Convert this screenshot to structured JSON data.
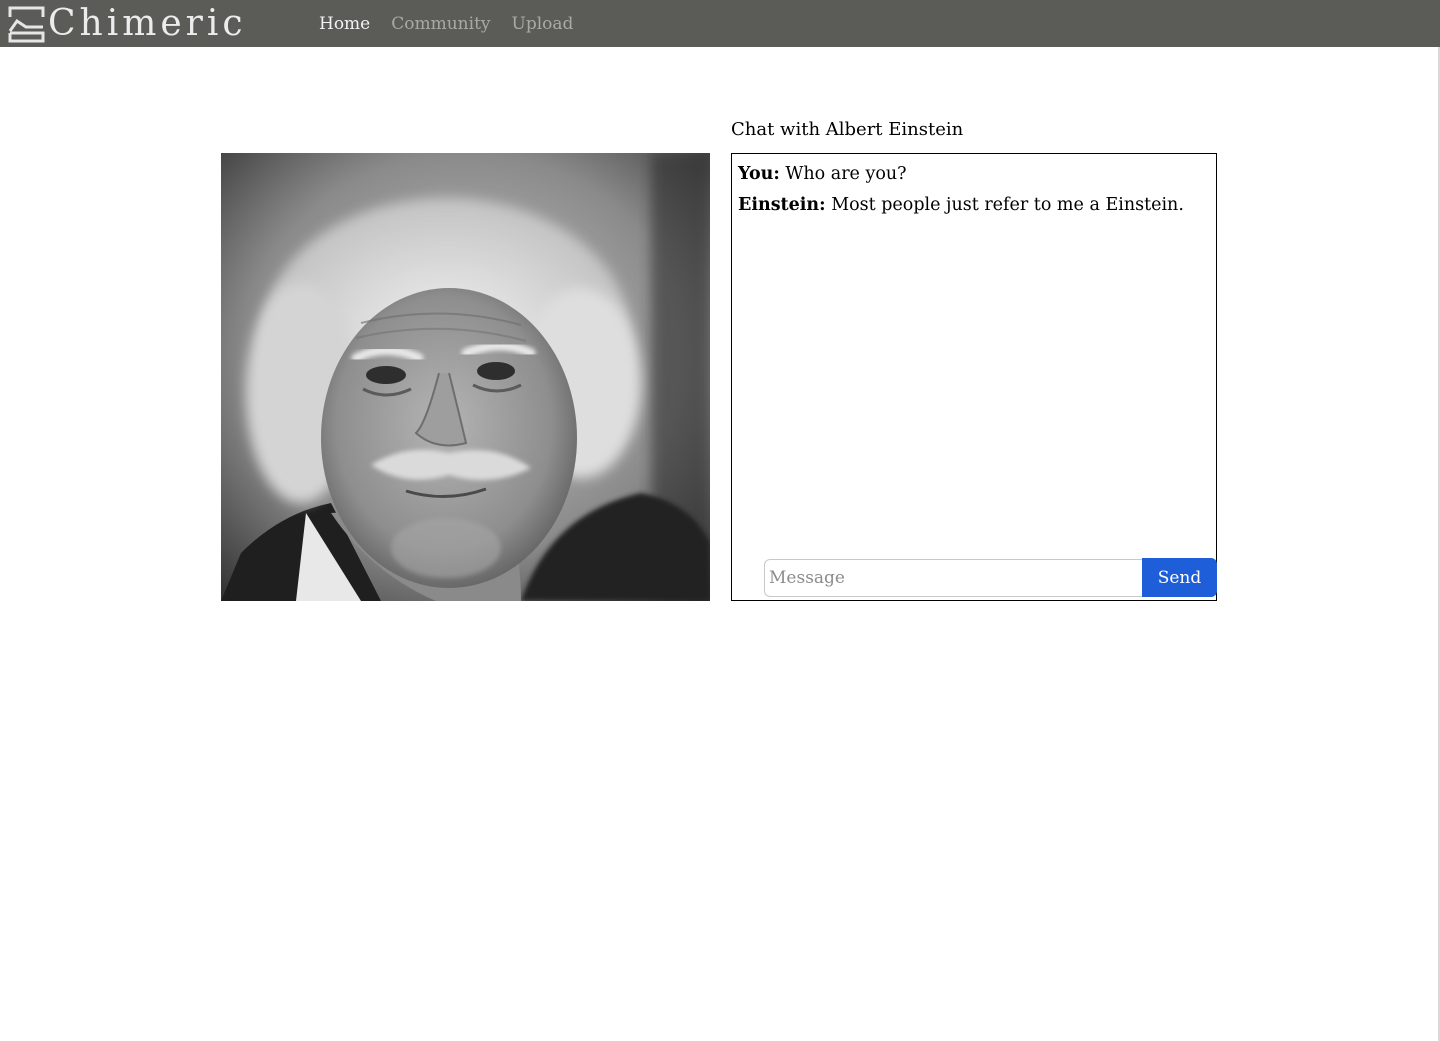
{
  "navbar": {
    "brand": "Chimeric",
    "links": [
      {
        "label": "Home",
        "active": true
      },
      {
        "label": "Community",
        "active": false
      },
      {
        "label": "Upload",
        "active": false
      }
    ]
  },
  "chat": {
    "title": "Chat with Albert Einstein",
    "messages": [
      {
        "sender": "You:",
        "text": "Who are you?"
      },
      {
        "sender": "Einstein:",
        "text": "Most people just refer to me a Einstein."
      }
    ],
    "input_placeholder": "Message",
    "send_label": "Send"
  },
  "colors": {
    "navbar_bg": "#5b5c58",
    "send_button": "#1e5fd9",
    "nav_active": "#f2f2f2",
    "nav_inactive": "#a9a9a6"
  }
}
